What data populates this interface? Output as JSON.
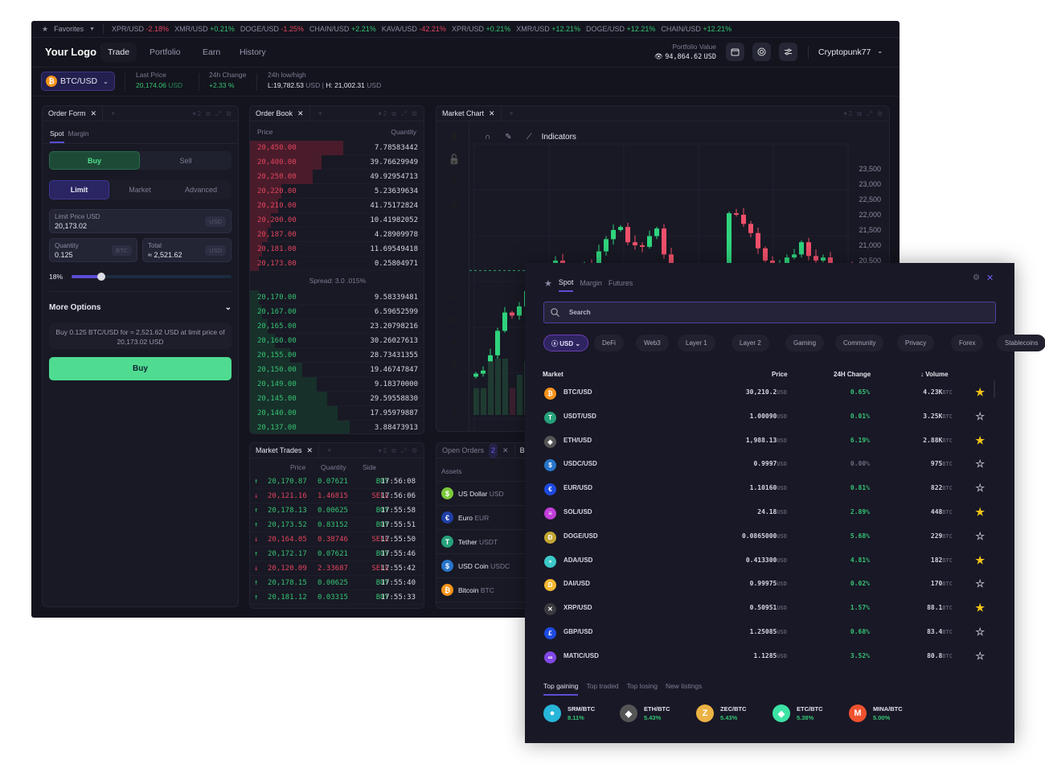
{
  "ticker": {
    "favorites": "Favorites",
    "items": [
      {
        "pair": "XPR/USD",
        "change": "-2.18%",
        "dir": "down"
      },
      {
        "pair": "XMR/USD",
        "change": "+0.21%",
        "dir": "up"
      },
      {
        "pair": "DOGE/USD",
        "change": "-1.25%",
        "dir": "down"
      },
      {
        "pair": "CHAIN/USD",
        "change": "+2.21%",
        "dir": "up"
      },
      {
        "pair": "KAVA/USD",
        "change": "-42.21%",
        "dir": "down"
      },
      {
        "pair": "XPR/USD",
        "change": "+0.21%",
        "dir": "up"
      },
      {
        "pair": "XMR/USD",
        "change": "+12.21%",
        "dir": "up"
      },
      {
        "pair": "DOGE/USD",
        "change": "+12.21%",
        "dir": "up"
      },
      {
        "pair": "CHAIN/USD",
        "change": "+12.21%",
        "dir": "up"
      }
    ]
  },
  "header": {
    "logo": "Your Logo",
    "nav": [
      "Trade",
      "Portfolio",
      "Earn",
      "History"
    ],
    "portfolio_label": "Portfolio Value",
    "portfolio_value": "94,864.62",
    "portfolio_unit": "USD",
    "user": "Cryptopunk77"
  },
  "pair": {
    "symbol": "BTC/USD",
    "last_price_label": "Last Price",
    "last_price": "20,174.06",
    "last_price_unit": "USD",
    "change_label": "24h Change",
    "change": "+2.33 %",
    "lowhigh_label": "24h low/high",
    "low": "L:19,782.53",
    "low_unit": "USD",
    "high": "H: 21,002.31",
    "high_unit": "USD"
  },
  "panel_count": "2",
  "order_form": {
    "title": "Order Form",
    "tabs": [
      "Spot",
      "Margin"
    ],
    "buy": "Buy",
    "sell": "Sell",
    "types": [
      "Limit",
      "Market",
      "Advanced"
    ],
    "limit_label": "Limit Price USD",
    "limit_value": "20,173.02",
    "limit_unit": "USD",
    "qty_label": "Quantity",
    "qty_value": "0.125",
    "qty_unit": "BTC",
    "total_label": "Total",
    "total_value": "≈ 2,521.62",
    "total_unit": "USD",
    "percent_label": "18%",
    "percent": 18,
    "more_options": "More Options",
    "summary": "Buy 0.125 BTC/USD for ≈ 2,521.62 USD at limit price of 20,173.02 USD",
    "submit": "Buy"
  },
  "order_book": {
    "title": "Order Book",
    "price_header": "Price",
    "qty_header": "Quantity",
    "spread": "Spread: 3.0 .015%",
    "asks": [
      {
        "price": "20,450.00",
        "qty": "7.78583442",
        "depth": 0.53
      },
      {
        "price": "20,400.00",
        "qty": "39.76629949",
        "depth": 0.41
      },
      {
        "price": "20,250.00",
        "qty": "49.92954713",
        "depth": 0.36
      },
      {
        "price": "20,220.00",
        "qty": "5.23639634",
        "depth": 0.18
      },
      {
        "price": "20,210.00",
        "qty": "41.75172824",
        "depth": 0.16
      },
      {
        "price": "20,200.00",
        "qty": "10.41982052",
        "depth": 0.12
      },
      {
        "price": "20,187.00",
        "qty": "4.28909978",
        "depth": 0.1
      },
      {
        "price": "20,181.00",
        "qty": "11.69549418",
        "depth": 0.07
      },
      {
        "price": "20,173.00",
        "qty": "0.25804971",
        "depth": 0.05
      }
    ],
    "bids": [
      {
        "price": "20,170.00",
        "qty": "9.58339481",
        "depth": 0.05
      },
      {
        "price": "20,167.00",
        "qty": "6.59652599",
        "depth": 0.07
      },
      {
        "price": "20,165.00",
        "qty": "23.20798216",
        "depth": 0.1
      },
      {
        "price": "20,160.00",
        "qty": "30.26027613",
        "depth": 0.14
      },
      {
        "price": "20,155.00",
        "qty": "28.73431355",
        "depth": 0.23
      },
      {
        "price": "20,150.00",
        "qty": "19.46747847",
        "depth": 0.3
      },
      {
        "price": "20,149.00",
        "qty": "9.18370000",
        "depth": 0.38
      },
      {
        "price": "20,145.00",
        "qty": "29.59558830",
        "depth": 0.44
      },
      {
        "price": "20,140.00",
        "qty": "17.95979887",
        "depth": 0.5
      },
      {
        "price": "20,137.00",
        "qty": "3.88473913",
        "depth": 0.57
      }
    ]
  },
  "market_trades": {
    "title": "Market Trades",
    "headers": [
      "Price",
      "Quantity",
      "Side"
    ],
    "rows": [
      {
        "price": "20,170.87",
        "qty": "0.07621",
        "side": "BUY",
        "time": "17:56:08"
      },
      {
        "price": "20,121.16",
        "qty": "1.46815",
        "side": "SELL",
        "time": "17:56:06"
      },
      {
        "price": "20,178.13",
        "qty": "0.00625",
        "side": "BUY",
        "time": "17:55:58"
      },
      {
        "price": "20,173.52",
        "qty": "0.83152",
        "side": "BUY",
        "time": "17:55:51"
      },
      {
        "price": "20,164.05",
        "qty": "0.38746",
        "side": "SELL",
        "time": "17:55:50"
      },
      {
        "price": "20,172.17",
        "qty": "0.07621",
        "side": "BUY",
        "time": "17:55:46"
      },
      {
        "price": "20,120.09",
        "qty": "2.33687",
        "side": "SELL",
        "time": "17:55:42"
      },
      {
        "price": "20,178.15",
        "qty": "0.00625",
        "side": "BUY",
        "time": "17:55:40"
      },
      {
        "price": "20,181.12",
        "qty": "0.03315",
        "side": "BUY",
        "time": "17:55:33"
      }
    ]
  },
  "chart": {
    "title": "Market Chart",
    "indicators": "Indicators",
    "axis_ticks": [
      "23,500",
      "23,000",
      "22,500",
      "22,000",
      "21,500",
      "21,000",
      "20,500"
    ],
    "current_price": "20,174",
    "current": 20174,
    "closes": [
      16800,
      16900,
      17400,
      18200,
      18800,
      18700,
      19000,
      19500,
      19800,
      19600,
      20300,
      20500,
      20250,
      20100,
      20000,
      20400,
      20300,
      20800,
      21200,
      21500,
      21600,
      21100,
      21000,
      20950,
      21300,
      21550,
      20700,
      20200,
      19900,
      19600,
      19500,
      19300,
      19600,
      19900,
      20200,
      22050,
      22000,
      21700,
      21400,
      20900,
      20500,
      20100,
      20300,
      20600,
      20700,
      21100,
      20650,
      20500,
      20600,
      20350,
      20200,
      20250,
      20174
    ]
  },
  "open_orders": {
    "title": "Open Orders",
    "count": "2",
    "next_tab": "Ba",
    "assets_label": "Assets",
    "assets": [
      {
        "name": "US Dollar",
        "code": "USD",
        "icon": "$",
        "color": "#7cc93a"
      },
      {
        "name": "Euro",
        "code": "EUR",
        "icon": "€",
        "color": "#1f3fa8"
      },
      {
        "name": "Tether",
        "code": "USDT",
        "icon": "T",
        "color": "#26a17b"
      },
      {
        "name": "USD Coin",
        "code": "USDC",
        "icon": "$",
        "color": "#2775ca"
      },
      {
        "name": "Bitcoin",
        "code": "BTC",
        "icon": "₿",
        "color": "#f7931a"
      }
    ]
  },
  "market_selector": {
    "tabs": [
      "Spot",
      "Margin",
      "Futures"
    ],
    "search_placeholder": "Search",
    "currency": "USD",
    "chips": [
      "DeFi",
      "Web3",
      "Layer 1",
      "Layer 2",
      "Gaming",
      "Community",
      "Privacy",
      "Forex",
      "Stablecoins"
    ],
    "headers": [
      "Market",
      "Price",
      "24H Change",
      "Volume"
    ],
    "price_unit": "USD",
    "vol_unit": "BTC",
    "rows": [
      {
        "pair": "BTC/USD",
        "price": "30,210.2",
        "change": "0.65%",
        "volume": "4.23K",
        "fav": true,
        "icon": "₿",
        "color": "#f7931a"
      },
      {
        "pair": "USDT/USD",
        "price": "1.00090",
        "change": "0.01%",
        "volume": "3.25K",
        "fav": false,
        "icon": "T",
        "color": "#26a17b"
      },
      {
        "pair": "ETH/USD",
        "price": "1,988.13",
        "change": "6.19%",
        "volume": "2.88K",
        "fav": true,
        "icon": "◆",
        "color": "#555"
      },
      {
        "pair": "USDC/USD",
        "price": "0.9997",
        "change": "0.00%",
        "volume": "975",
        "fav": false,
        "icon": "$",
        "color": "#2775ca"
      },
      {
        "pair": "EUR/USD",
        "price": "1.10160",
        "change": "0.81%",
        "volume": "822",
        "fav": false,
        "icon": "€",
        "color": "#1f4ae0"
      },
      {
        "pair": "SOL/USD",
        "price": "24.18",
        "change": "2.89%",
        "volume": "448",
        "fav": true,
        "icon": "≡",
        "color": "#c03ed8"
      },
      {
        "pair": "DOGE/USD",
        "price": "0.0865000",
        "change": "5.68%",
        "volume": "229",
        "fav": false,
        "icon": "Ð",
        "color": "#c2a633"
      },
      {
        "pair": "ADA/USD",
        "price": "0.413300",
        "change": "4.81%",
        "volume": "182",
        "fav": true,
        "icon": "∘",
        "color": "#3cc8c8"
      },
      {
        "pair": "DAI/USD",
        "price": "0.99975",
        "change": "0.02%",
        "volume": "170",
        "fav": false,
        "icon": "D",
        "color": "#f4b731"
      },
      {
        "pair": "XRP/USD",
        "price": "0.50951",
        "change": "1.57%",
        "volume": "88.1",
        "fav": true,
        "icon": "✕",
        "color": "#3a3a3f"
      },
      {
        "pair": "GBP/USD",
        "price": "1.25085",
        "change": "0.68%",
        "volume": "83.4",
        "fav": false,
        "icon": "£",
        "color": "#1f4ae0"
      },
      {
        "pair": "MATIC/USD",
        "price": "1.1285",
        "change": "3.52%",
        "volume": "80.8",
        "fav": false,
        "icon": "∞",
        "color": "#8247e5"
      }
    ],
    "bottom_tabs": [
      "Top gaining",
      "Top traded",
      "Top losing",
      "New listings"
    ],
    "gainers": [
      {
        "pair": "SRM/BTC",
        "change": "8.11%",
        "icon": "●",
        "color": "#27b5d9"
      },
      {
        "pair": "ETH/BTC",
        "change": "5.43%",
        "icon": "◆",
        "color": "#555"
      },
      {
        "pair": "ZEC/BTC",
        "change": "5.43%",
        "icon": "Z",
        "color": "#ecb244"
      },
      {
        "pair": "ETC/BTC",
        "change": "5.38%",
        "icon": "◆",
        "color": "#3ce3a5"
      },
      {
        "pair": "MINA/BTC",
        "change": "5.00%",
        "icon": "M",
        "color": "#f0522f"
      }
    ]
  },
  "colors": {
    "green": "#35c374",
    "red": "#e3445f",
    "accent": "#5b4dd6",
    "star": "#f5c518"
  }
}
